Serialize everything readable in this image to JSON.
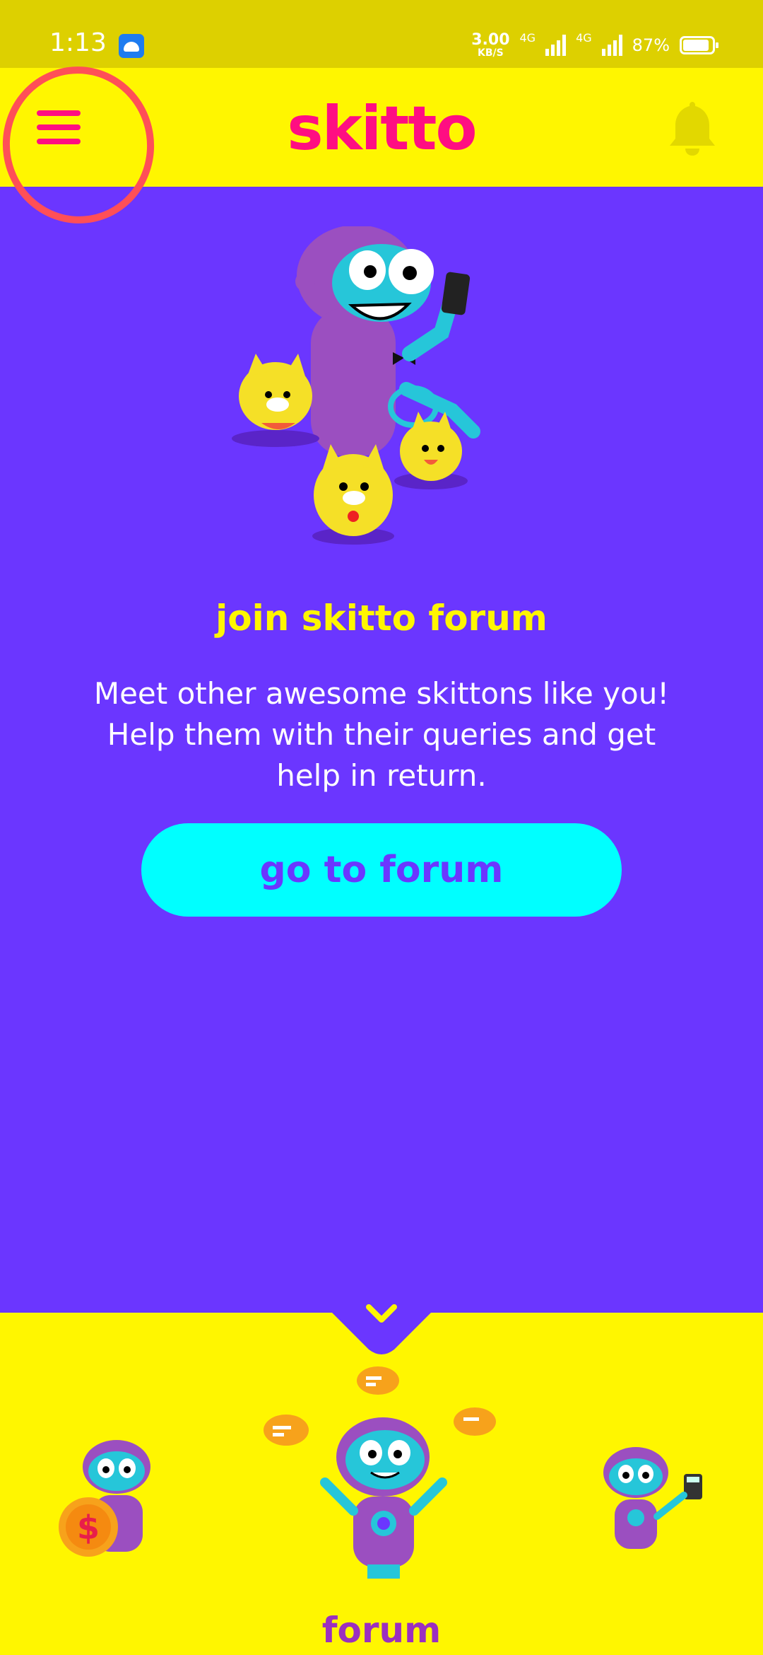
{
  "status_bar": {
    "time": "1:13",
    "speed_value": "3.00",
    "speed_unit": "KB/S",
    "network_1": "4G",
    "network_2": "4G",
    "battery": "87%"
  },
  "header": {
    "logo": "skitto",
    "menu_icon": "hamburger-menu-icon",
    "bell_icon": "bell-icon"
  },
  "main": {
    "title": "join skitto forum",
    "description": "Meet other awesome skittons like you! Help them with their queries and get help in return.",
    "button_label": "go to forum"
  },
  "bottom": {
    "active_label": "forum"
  },
  "colors": {
    "status_bar": "#ddd000",
    "header": "#fff600",
    "background": "#6b36ff",
    "accent_pink": "#ff0e82",
    "button": "#00ffff",
    "title_yellow": "#fff600",
    "label_purple": "#9b2fbf",
    "annotation": "#ff4f57"
  }
}
